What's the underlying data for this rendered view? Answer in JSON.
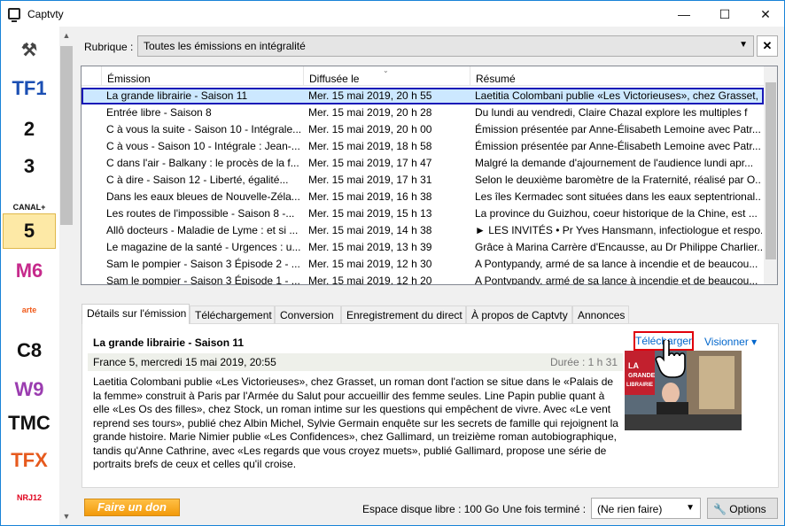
{
  "window": {
    "title": "Captvty",
    "minimize": "—",
    "maximize": "☐",
    "close": "✕"
  },
  "channels": [
    {
      "id": "tools",
      "label": "⚒",
      "color": "#444"
    },
    {
      "id": "tf1",
      "label": "TF1",
      "color": "#1b4fb3"
    },
    {
      "id": "france2",
      "label": "2",
      "color": "#111"
    },
    {
      "id": "france3",
      "label": "3",
      "color": "#111"
    },
    {
      "id": "canalplus",
      "label": "CANAL+",
      "color": "#111"
    },
    {
      "id": "france5",
      "label": "5",
      "color": "#111"
    },
    {
      "id": "m6",
      "label": "M6",
      "color": "#c62a8c"
    },
    {
      "id": "arte",
      "label": "arte",
      "color": "#f05a1a"
    },
    {
      "id": "c8",
      "label": "C8",
      "color": "#111"
    },
    {
      "id": "w9",
      "label": "W9",
      "color": "#9b3db0"
    },
    {
      "id": "tmc",
      "label": "TMC",
      "color": "#111"
    },
    {
      "id": "tfx",
      "label": "TFX",
      "color": "#e65a1e"
    },
    {
      "id": "nrj12",
      "label": "NRJ12",
      "color": "#e0001b"
    }
  ],
  "rubrique": {
    "label": "Rubrique :",
    "value": "Toutes les émissions en intégralité",
    "clear": "✕"
  },
  "list": {
    "headers": [
      "Émission",
      "Diffusée le",
      "Résumé"
    ],
    "rows": [
      [
        "La grande librairie - Saison 11",
        "Mer. 15 mai 2019, 20 h 55",
        "Laetitia Colombani publie «Les Victorieuses», chez Grasset, u"
      ],
      [
        "Entrée libre - Saison 8",
        "Mer. 15 mai 2019, 20 h 28",
        "Du lundi au vendredi, Claire Chazal explore les multiples f"
      ],
      [
        "C à vous la suite - Saison 10 - Intégrale...",
        "Mer. 15 mai 2019, 20 h 00",
        "Émission présentée par Anne-Élisabeth Lemoine avec Patr..."
      ],
      [
        "C à vous - Saison 10 - Intégrale : Jean-...",
        "Mer. 15 mai 2019, 18 h 58",
        "Émission présentée par Anne-Élisabeth Lemoine avec Patr..."
      ],
      [
        "C dans l'air - Balkany : le procès de la f...",
        "Mer. 15 mai 2019, 17 h 47",
        "Malgré la demande d'ajournement de l'audience lundi apr..."
      ],
      [
        "C à dire - Saison 12 - Liberté, égalité...",
        "Mer. 15 mai 2019, 17 h 31",
        "Selon le deuxième baromètre de la Fraternité, réalisé par O..."
      ],
      [
        "Dans les eaux bleues de Nouvelle-Zéla...",
        "Mer. 15 mai 2019, 16 h 38",
        "Les îles Kermadec sont situées dans les eaux septentrional..."
      ],
      [
        "Les routes de l'impossible - Saison 8 -...",
        "Mer. 15 mai 2019, 15 h 13",
        "La province du Guizhou, coeur historique de la Chine, est ..."
      ],
      [
        "Allô docteurs - Maladie de Lyme : et si ...",
        "Mer. 15 mai 2019, 14 h 38",
        "► LES INVITÉS • Pr Yves Hansmann, infectiologue et respo..."
      ],
      [
        "Le magazine de la santé - Urgences : u...",
        "Mer. 15 mai 2019, 13 h 39",
        "Grâce à Marina Carrère d'Encausse, au Dr Philippe Charlier..."
      ],
      [
        "Sam le pompier - Saison 3 Épisode 2 - ...",
        "Mer. 15 mai 2019, 12 h 30",
        "A Pontypandy, armé de sa lance à incendie et de beaucou..."
      ],
      [
        "Sam le pompier - Saison 3 Épisode 1 - ...",
        "Mer. 15 mai 2019, 12 h 20",
        "A Pontypandy, armé de sa lance à incendie et de beaucou..."
      ]
    ]
  },
  "tabs": [
    "Détails sur l'émission",
    "Téléchargement",
    "Conversion",
    "Enregistrement du direct",
    "À propos de Captvty",
    "Annonces"
  ],
  "detail": {
    "title": "La grande librairie - Saison 11",
    "download": "Télécharger",
    "watch": "Visionner ▾",
    "meta": "France 5, mercredi 15 mai 2019, 20:55",
    "duration": "Durée : 1 h 31",
    "description": "Laetitia Colombani publie «Les Victorieuses», chez Grasset, un roman dont l'action se situe dans le «Palais de la femme» construit à Paris par l'Armée du Salut pour accueillir des femme seules. Line Papin publie quant à elle «Les Os des filles», chez Stock, un roman intime sur les questions qui empêchent de vivre. Avec «Le vent reprend ses tours», publié chez Albin Michel, Sylvie Germain enquête sur les secrets de famille qui rejoignent la grande histoire. Marie Nimier publie «Les Confidences», chez Gallimard, un treizième roman autobiographique, tandis qu'Anne Cathrine, avec «Les regards que vous croyez muets», publié Gallimard, propose une série de portraits brefs de ceux et celles qu'il croise.",
    "thumb_text": "LA GRANDE LIBRAIRIE"
  },
  "footer": {
    "donate": "Faire un don",
    "disk": "Espace disque libre : 100 Go",
    "once_label": "Une fois terminé :",
    "once_value": "(Ne rien faire)",
    "options": "Options"
  },
  "colors": {
    "selection_outline": "#1a1ab8",
    "highlight": "#e0000b",
    "link": "#0066cc"
  }
}
